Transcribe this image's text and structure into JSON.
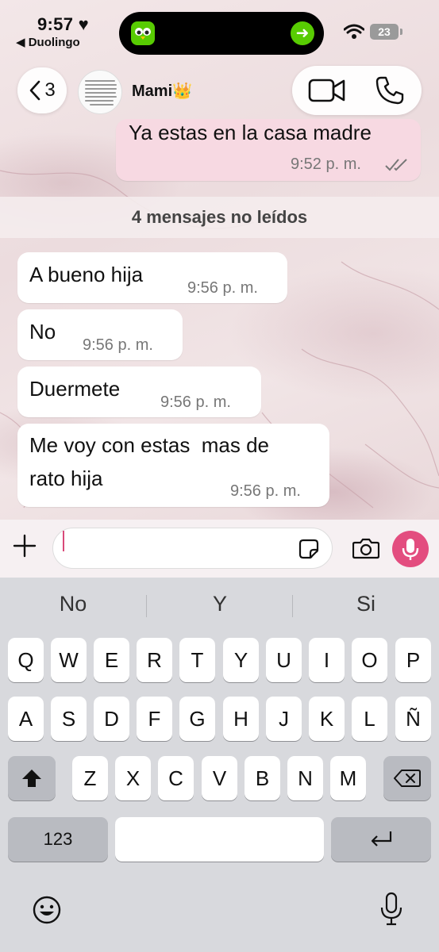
{
  "status_bar": {
    "time": "9:57",
    "back_app": "◀ Duolingo",
    "battery": "23"
  },
  "chat_header": {
    "back_count": "3",
    "contact_name": "Mami👑"
  },
  "messages": {
    "outgoing_partial": {
      "text": "Ya estas en la casa madre",
      "time": "9:52 p. m."
    },
    "unread_label": "4 mensajes no leídos",
    "incoming": [
      {
        "text": "A bueno hija",
        "time": "9:56 p. m."
      },
      {
        "text": "No",
        "time": "9:56 p. m."
      },
      {
        "text": "Duermete",
        "time": "9:56 p. m."
      },
      {
        "text_line1": "Me voy con estas  mas de",
        "text_line2": "rato hija",
        "time": "9:56 p. m."
      }
    ]
  },
  "input_bar": {
    "value": ""
  },
  "keyboard": {
    "suggestions": [
      "No",
      "Y",
      "Si"
    ],
    "row1": [
      "Q",
      "W",
      "E",
      "R",
      "T",
      "Y",
      "U",
      "I",
      "O",
      "P"
    ],
    "row2": [
      "A",
      "S",
      "D",
      "F",
      "G",
      "H",
      "J",
      "K",
      "L",
      "Ñ"
    ],
    "row3": [
      "Z",
      "X",
      "C",
      "V",
      "B",
      "N",
      "M"
    ],
    "numbers_key": "123"
  },
  "colors": {
    "accent": "#e34d7f",
    "outgoing_bubble": "#f7d9e2",
    "duolingo_green": "#58cc02"
  }
}
